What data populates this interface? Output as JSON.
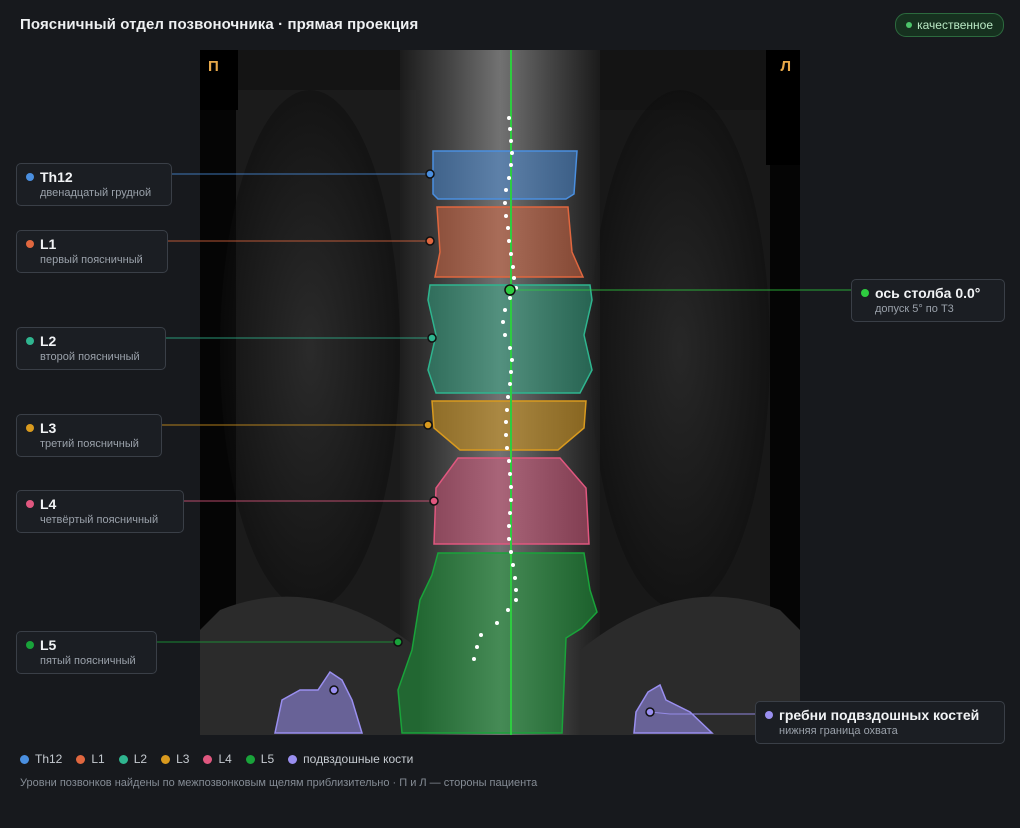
{
  "header": {
    "title": "Поясничный отдел позвоночника · прямая проекция",
    "quality_label": "качественное"
  },
  "viewer": {
    "right_marker": "П",
    "left_marker": "Л"
  },
  "colors": {
    "th12": "#4a8fe0",
    "l1": "#e0673f",
    "l2": "#2fb58f",
    "l3": "#d99a1e",
    "l4": "#e0577f",
    "l5": "#19a33a",
    "ilium": "#9a8ff0",
    "axis": "#2ecc40"
  },
  "labels": {
    "th12": {
      "name": "Th12",
      "desc": "двенадцатый грудной"
    },
    "l1": {
      "name": "L1",
      "desc": "первый поясничный"
    },
    "l2": {
      "name": "L2",
      "desc": "второй поясничный"
    },
    "l3": {
      "name": "L3",
      "desc": "третий поясничный"
    },
    "l4": {
      "name": "L4",
      "desc": "четвёртый поясничный"
    },
    "l5": {
      "name": "L5",
      "desc": "пятый поясничный"
    },
    "axis": {
      "name": "ось столба 0.0°",
      "desc": "допуск 5° по T3"
    },
    "ilium": {
      "name": "гребни подвздошных костей",
      "desc": "нижняя граница охвата"
    }
  },
  "legend": {
    "th12": "Th12",
    "l1": "L1",
    "l2": "L2",
    "l3": "L3",
    "l4": "L4",
    "l5": "L5",
    "ilium": "подвздошные кости"
  },
  "footnote": "Уровни позвонков найдены по межпозвонковым щелям приблизительно · П и Л — стороны пациента"
}
